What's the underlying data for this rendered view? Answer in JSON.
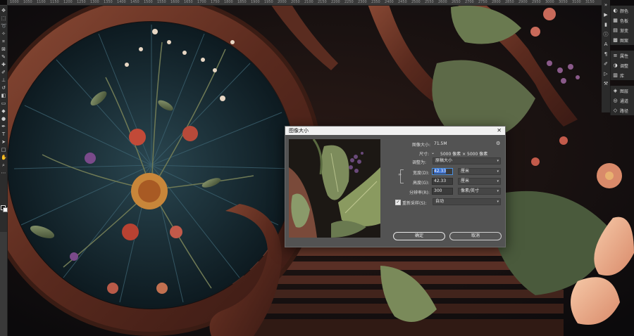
{
  "ruler": {
    "ticks": [
      "1000",
      "1050",
      "1100",
      "1150",
      "1200",
      "1250",
      "1300",
      "1350",
      "1400",
      "1450",
      "1500",
      "1550",
      "1600",
      "1650",
      "1700",
      "1750",
      "1800",
      "1850",
      "1900",
      "1950",
      "2000",
      "2050",
      "2100",
      "2150",
      "2200",
      "2250",
      "2300",
      "2350",
      "2400",
      "2450",
      "2500",
      "2550",
      "2600",
      "2650",
      "2700",
      "2750",
      "2800",
      "2850",
      "2900",
      "2950",
      "3000",
      "3050",
      "3100",
      "3150"
    ]
  },
  "panels": {
    "group1": [
      {
        "icon": "palette-icon",
        "glyph": "◐",
        "label": "颜色"
      },
      {
        "icon": "swatches-icon",
        "glyph": "▦",
        "label": "色板"
      },
      {
        "icon": "gradient-icon",
        "glyph": "▤",
        "label": "渐变"
      },
      {
        "icon": "pattern-icon",
        "glyph": "▩",
        "label": "图案"
      }
    ],
    "group2": [
      {
        "icon": "properties-icon",
        "glyph": "≡",
        "label": "属性"
      },
      {
        "icon": "adjustments-icon",
        "glyph": "◑",
        "label": "调整"
      },
      {
        "icon": "libraries-icon",
        "glyph": "▥",
        "label": "库"
      }
    ],
    "group3": [
      {
        "icon": "layers-icon",
        "glyph": "◈",
        "label": "图层"
      },
      {
        "icon": "channels-icon",
        "glyph": "◎",
        "label": "通道"
      },
      {
        "icon": "paths-icon",
        "glyph": "◇",
        "label": "路径"
      }
    ]
  },
  "dialog": {
    "title": "图像大小",
    "image_size_label": "图像大小:",
    "image_size_value": "71.5M",
    "dimensions_label": "尺寸:",
    "dimensions_value": "5000 像素 × 5000 像素",
    "fit_label": "调整为:",
    "fit_value": "原稿大小",
    "width_label": "宽度(D):",
    "width_value": "42.33",
    "width_unit": "厘米",
    "height_label": "高度(G):",
    "height_value": "42.33",
    "height_unit": "厘米",
    "resolution_label": "分辨率(R):",
    "resolution_value": "300",
    "resolution_unit": "像素/英寸",
    "resample_label": "重新采样(S):",
    "resample_checked": true,
    "resample_value": "自动",
    "ok_label": "确定",
    "cancel_label": "取消"
  }
}
